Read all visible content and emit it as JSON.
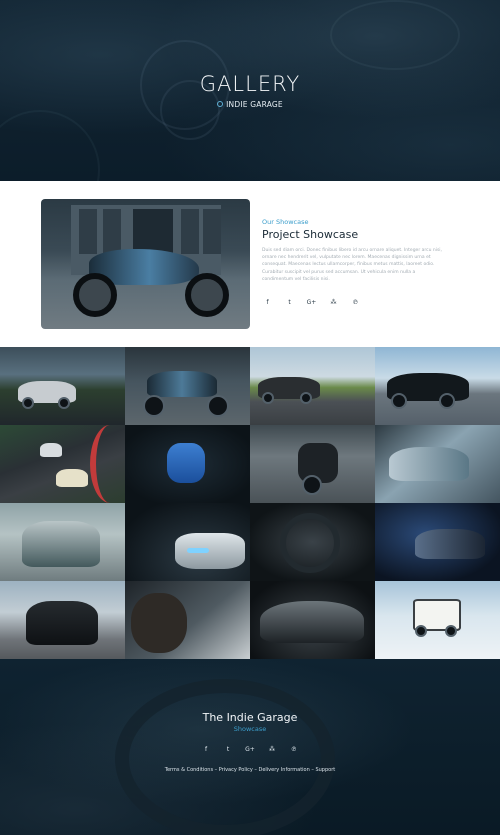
{
  "hero": {
    "title": "GALLERY",
    "breadcrumb": "INDIE GARAGE"
  },
  "showcase": {
    "kicker": "Our Showcase",
    "title": "Project Showcase",
    "body": "Duis sed diam orci. Donec finibus libero id arcu ornare aliquet. Integer arcu nisi, ornare nec hendrerit vel, vulputate nec lorem. Maecenas dignissim urna et consequat. Maecenas lectus ullamcorper, finibus metus mattis, laoreet odio. Curabitur suscipit vel purus sed accumsan. Ut vehicula enim nulla a condimentum vel facilisis nisi.",
    "social": [
      "f",
      "t",
      "G+",
      "rss",
      "p"
    ]
  },
  "gallery": {
    "tiles": [
      "road-sedan",
      "black-motorcycle",
      "mustang-field",
      "bmw-sedan",
      "race-track",
      "blue-sportscar",
      "cafe-racer",
      "engine-bay",
      "nissan-gtr",
      "audi-headlight",
      "engine-closeup",
      "welding",
      "mustang-front",
      "mechanic",
      "classic-roadster",
      "defender-offroad"
    ]
  },
  "footer": {
    "title": "The Indie Garage",
    "subtitle": "Showcase",
    "social": [
      "f",
      "t",
      "G+",
      "rss",
      "p"
    ],
    "links": "Terms & Conditions – Privacy Policy – Delivery Information – Support"
  },
  "colors": {
    "accent": "#3c9ecb",
    "dark": "#0b1a26",
    "title_text": "#1a2a36"
  }
}
